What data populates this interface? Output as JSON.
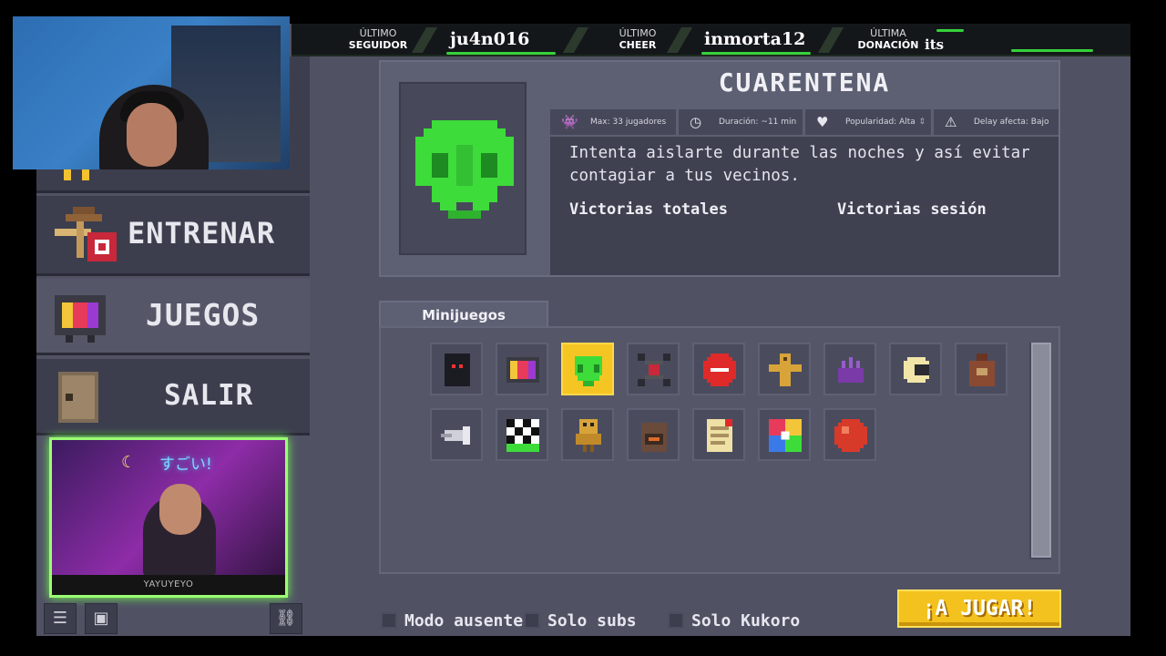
{
  "stream_bar": {
    "last_follower": {
      "label_top": "ÚLTIMO",
      "label_bottom": "SEGUIDOR",
      "name": "ju4n016"
    },
    "last_cheer": {
      "label_top": "ÚLTIMO",
      "label_bottom": "CHEER",
      "name": "inmorta12"
    },
    "last_donation": {
      "label_top": "ÚLTIMA",
      "label_bottom": "DONACIÓN",
      "name": "its"
    }
  },
  "webcam": {
    "overlay_text": "すごい!",
    "streamer_tag": "YAYUYEYO"
  },
  "menu": {
    "entrenar": "ENTRENAR",
    "juegos": "JUEGOS",
    "salir": "SALIR"
  },
  "game": {
    "title": "CUARENTENA",
    "stats": {
      "players": "Max: 33 jugadores",
      "duration": "Duración: ~11 min",
      "popularity": "Popularidad: Alta",
      "delay": "Delay afecta: Bajo"
    },
    "description": "Intenta aislarte durante las noches y así evitar contagiar a tus vecinos.",
    "total_wins_label": "Victorias totales",
    "session_wins_label": "Victorias sesión",
    "accent_color": "#3ddc3a"
  },
  "minigames": {
    "tab_label": "Minijuegos",
    "selected_index": 2,
    "items": [
      "dark-robot-icon",
      "tv-icon",
      "green-skull-icon",
      "crosshair-icon",
      "stop-sign-icon",
      "ankh-icon",
      "purple-creature-icon",
      "pacman-ball-icon",
      "backpack-icon",
      "arrow-trap-icon",
      "checkered-flag-icon",
      "yellow-robot-icon",
      "furnace-icon",
      "paper-note-icon",
      "color-wheel-icon",
      "red-ball-icon"
    ]
  },
  "options": {
    "away_mode": "Modo ausente",
    "subs_only": "Solo subs",
    "kukoro_only": "Solo Kukoro"
  },
  "play_button": "¡A JUGAR!"
}
